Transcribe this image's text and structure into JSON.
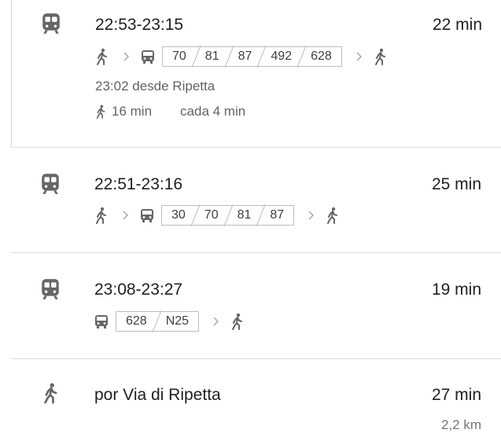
{
  "routes": [
    {
      "times": "22:53-23:15",
      "duration": "22 min",
      "lines": [
        "70",
        "81",
        "87",
        "492",
        "628"
      ],
      "departure": "23:02 desde Ripetta",
      "walk_time": "16 min",
      "frequency": "cada 4 min"
    },
    {
      "times": "22:51-23:16",
      "duration": "25 min",
      "lines": [
        "30",
        "70",
        "81",
        "87"
      ]
    },
    {
      "times": "23:08-23:27",
      "duration": "19 min",
      "lines": [
        "628",
        "N25"
      ]
    },
    {
      "description": "por Via di Ripetta",
      "duration": "27 min",
      "distance": "2,2 km"
    }
  ],
  "colors": {
    "icon": "#666666",
    "text": "#202124",
    "secondary": "#5f6368",
    "divider": "#dcdcdc"
  }
}
